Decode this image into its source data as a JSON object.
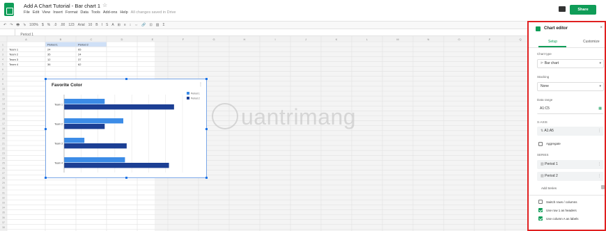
{
  "header": {
    "title": "Add A Chart Tutorial - Bar chart 1",
    "star": "☆",
    "share": "Share",
    "menus": [
      "File",
      "Edit",
      "View",
      "Insert",
      "Format",
      "Data",
      "Tools",
      "Add-ons",
      "Help"
    ],
    "save_status": "All changes saved in Drive"
  },
  "toolbar": {
    "items": [
      "↶",
      "↷",
      "🖶",
      "⮷",
      "100%",
      "$",
      "%",
      ".0",
      ".00",
      "123",
      "Arial",
      "10",
      "B",
      "I",
      "S",
      "A",
      "⊞",
      "≡",
      "↕",
      "⇔",
      "🔗",
      "⊡",
      "▥",
      "Σ"
    ]
  },
  "formula": {
    "cell_ref": "",
    "fx": "Period 1"
  },
  "sheet": {
    "columns": [
      "A",
      "B",
      "C",
      "D",
      "E",
      "F",
      "G",
      "H",
      "I",
      "J",
      "K",
      "L",
      "M",
      "N",
      "O",
      "P",
      "Q"
    ],
    "headers": [
      "",
      "Period 1",
      "Period 2"
    ],
    "rows": [
      [
        "Team 1",
        "24",
        "65"
      ],
      [
        "Team 2",
        "35",
        "24"
      ],
      [
        "Team 3",
        "12",
        "37"
      ],
      [
        "Team 4",
        "36",
        "62"
      ]
    ]
  },
  "chart_data": {
    "type": "bar",
    "title": "Favorite Color",
    "categories": [
      "Team 1",
      "Team 2",
      "Team 3",
      "Team 4"
    ],
    "series": [
      {
        "name": "Period 1",
        "values": [
          24,
          35,
          12,
          36
        ],
        "color": "#3c8ce7"
      },
      {
        "name": "Period 2",
        "values": [
          65,
          24,
          37,
          62
        ],
        "color": "#1c3f94"
      }
    ],
    "xlim": [
      0,
      70
    ],
    "legend": "top-right",
    "grid": true
  },
  "editor": {
    "title": "Chart editor",
    "tabs": [
      "Setup",
      "Customize"
    ],
    "chart_type_label": "Chart type",
    "chart_type": "Bar chart",
    "stacking_label": "Stacking",
    "stacking": "None",
    "range_label": "Data range",
    "range": "A1:C5",
    "xaxis_label": "X-AXIS",
    "xaxis": "A1:A5",
    "aggregate": "Aggregate",
    "series_label": "SERIES",
    "series": [
      "Period 1",
      "Period 2"
    ],
    "add_series": "Add Series",
    "switch": "Switch rows / columns",
    "use_row": "Use row 1 as headers",
    "use_col": "Use column A as labels"
  },
  "watermark": {
    "text": "uantrimang"
  }
}
